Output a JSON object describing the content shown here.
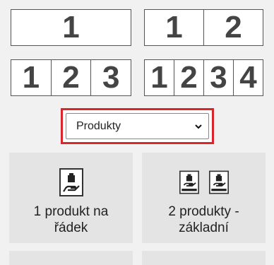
{
  "column_buttons": [
    {
      "id": "one",
      "cells": [
        "1"
      ]
    },
    {
      "id": "two",
      "cells": [
        "1",
        "2"
      ]
    },
    {
      "id": "three",
      "cells": [
        "1",
        "2",
        "3"
      ]
    },
    {
      "id": "four",
      "cells": [
        "1",
        "2",
        "3",
        "4"
      ]
    }
  ],
  "dropdown": {
    "selected": "Produkty",
    "highlight_color": "#d9252b"
  },
  "cards": [
    {
      "line1": "1 produkt na",
      "line2": "řádek",
      "icon": "product-hand-icon"
    },
    {
      "line1": "2 produkty -",
      "line2": "základní",
      "icon": "product-hand-icon"
    }
  ]
}
